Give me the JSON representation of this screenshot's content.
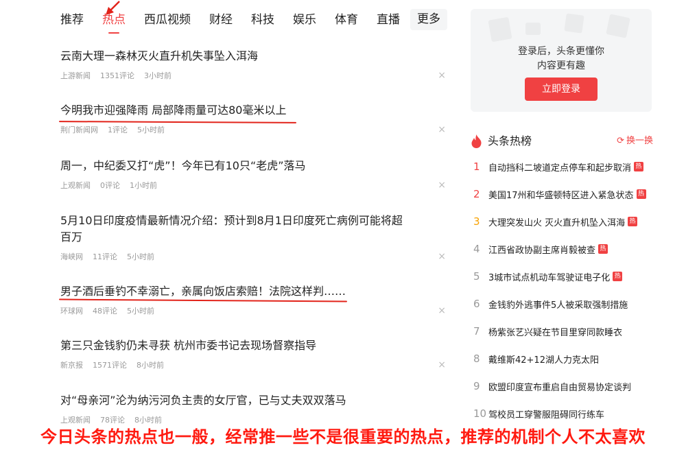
{
  "nav": {
    "items": [
      {
        "label": "推荐"
      },
      {
        "label": "热点",
        "active": true
      },
      {
        "label": "西瓜视频"
      },
      {
        "label": "财经"
      },
      {
        "label": "科技"
      },
      {
        "label": "娱乐"
      },
      {
        "label": "体育"
      },
      {
        "label": "直播"
      }
    ],
    "more_label": "更多"
  },
  "feed": [
    {
      "title": "云南大理一森林灭火直升机失事坠入洱海",
      "source": "上游新闻",
      "comments": "1351评论",
      "time": "3小时前"
    },
    {
      "title": "今明我市迎强降雨 局部降雨量可达80毫米以上",
      "source": "荆门新闻网",
      "comments": "1评论",
      "time": "5小时前"
    },
    {
      "title": "周一，中纪委又打“虎”！今年已有10只“老虎”落马",
      "source": "上观新闻",
      "comments": "0评论",
      "time": "1小时前"
    },
    {
      "title": "5月10日印度疫情最新情况介绍：预计到8月1日印度死亡病例可能将超百万",
      "source": "海峡网",
      "comments": "11评论",
      "time": "5小时前"
    },
    {
      "title": "男子酒后垂钓不幸溺亡，亲属向饭店索赔！法院这样判……",
      "source": "环球网",
      "comments": "48评论",
      "time": "5小时前"
    },
    {
      "title": "第三只金钱豹仍未寻获 杭州市委书记去现场督察指导",
      "source": "新京报",
      "comments": "1571评论",
      "time": "8小时前"
    },
    {
      "title": "对“母亲河”沦为纳污河负主责的女厅官，已与丈夫双双落马",
      "source": "上观新闻",
      "comments": "78评论",
      "time": "8小时前"
    }
  ],
  "feed_close_glyph": "×",
  "login": {
    "line1": "登录后，头条更懂你",
    "line2": "内容更有趣",
    "button": "立即登录"
  },
  "hot": {
    "title": "头条热榜",
    "refresh": "换一换",
    "badge": "热",
    "items": [
      {
        "rank": "1",
        "text": "自动挡科二坡道定点停车和起步取消",
        "hot": true
      },
      {
        "rank": "2",
        "text": "美国17州和华盛顿特区进入紧急状态",
        "hot": true
      },
      {
        "rank": "3",
        "text": "大理突发山火 灭火直升机坠入洱海",
        "hot": true
      },
      {
        "rank": "4",
        "text": "江西省政协副主席肖毅被查",
        "hot": true
      },
      {
        "rank": "5",
        "text": "3城市试点机动车驾驶证电子化",
        "hot": true
      },
      {
        "rank": "6",
        "text": "金钱豹外逃事件5人被采取强制措施",
        "hot": false
      },
      {
        "rank": "7",
        "text": "杨紫张艺兴疑在节目里穿同款睡衣",
        "hot": false
      },
      {
        "rank": "8",
        "text": "戴维斯42+12湖人力克太阳",
        "hot": false
      },
      {
        "rank": "9",
        "text": "欧盟印度宣布重启自由贸易协定谈判",
        "hot": false
      },
      {
        "rank": "10",
        "text": "驾校员工穿警服阻碍同行练车",
        "hot": false
      }
    ]
  },
  "caption": "今日头条的热点也一般，经常推一些不是很重要的热点，推荐的机制个人不太喜欢",
  "colors": {
    "accent": "#f04142",
    "annotation_red": "#e2231a",
    "rank3": "#f8a200"
  }
}
